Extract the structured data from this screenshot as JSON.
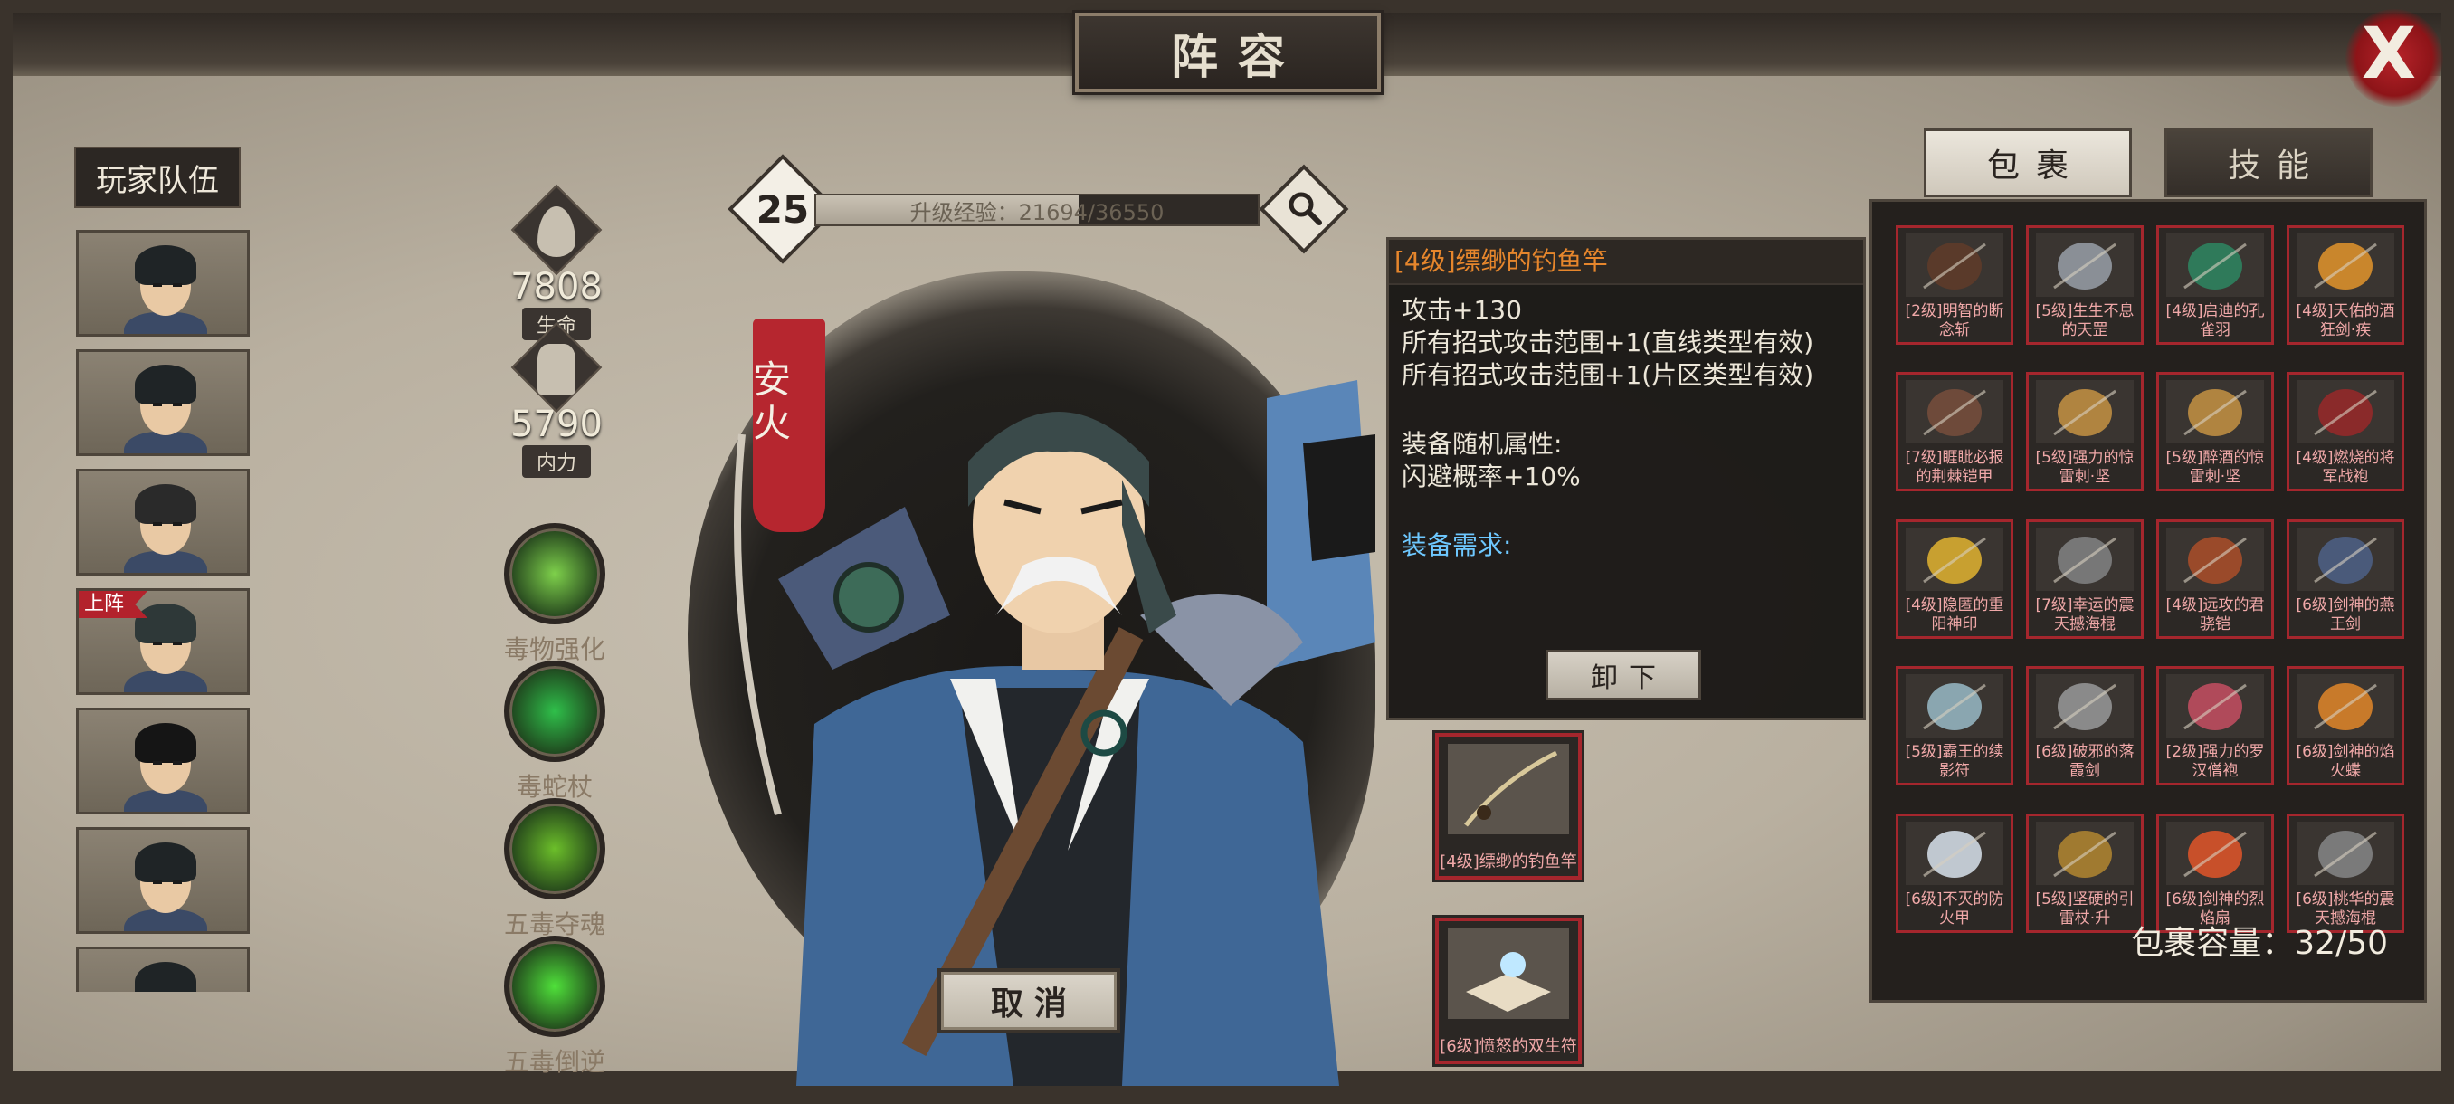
{
  "header": {
    "title": "阵容",
    "close_label": "X"
  },
  "roster": {
    "label": "玩家队伍",
    "heroes": [
      {
        "badge": ""
      },
      {
        "badge": ""
      },
      {
        "badge": ""
      },
      {
        "badge": "上阵"
      },
      {
        "badge": ""
      },
      {
        "badge": ""
      },
      {
        "badge": ""
      }
    ]
  },
  "stats": {
    "hp": {
      "value": "7808",
      "label": "生命"
    },
    "mp": {
      "value": "5790",
      "label": "内力"
    }
  },
  "skills": [
    {
      "name": "毒物强化",
      "color": "#7ed04b"
    },
    {
      "name": "毒蛇杖",
      "color": "#2fbf4a"
    },
    {
      "name": "五毒夺魂",
      "color": "#6cbf2a"
    },
    {
      "name": "五毒倒逆",
      "color": "#4fe03a"
    }
  ],
  "level": {
    "value": "25",
    "exp_label": "升级经验：21694/36550",
    "exp_current": 21694,
    "exp_max": 36550
  },
  "hero": {
    "name": "安火"
  },
  "cancel_label": "取消",
  "tooltip": {
    "title": "[4级]缥缈的钓鱼竿",
    "lines": [
      "攻击+130",
      "所有招式攻击范围+1(直线类型有效)",
      "所有招式攻击范围+1(片区类型有效)"
    ],
    "random_attr_label": "装备随机属性:",
    "random_attr": "闪避概率+10%",
    "requirement_label": "装备需求:",
    "unequip_label": "卸下"
  },
  "equipped": [
    {
      "name": "[4级]缥缈的钓鱼竿"
    },
    {
      "name": "[6级]愤怒的双生符"
    }
  ],
  "tabs": {
    "bag": "包裹",
    "skills": "技能"
  },
  "inventory": {
    "items": [
      {
        "name": "[2级]明智的断念斩",
        "color": "#5a3a2a"
      },
      {
        "name": "[5级]生生不息的天罡",
        "color": "#8a8f96"
      },
      {
        "name": "[4级]启迪的孔雀羽",
        "color": "#2f7a5a"
      },
      {
        "name": "[4级]天佑的酒狂剑·疾",
        "color": "#c9862c"
      },
      {
        "name": "[7级]睚眦必报的荆棘铠甲",
        "color": "#6e4a3a"
      },
      {
        "name": "[5级]强力的惊雷刺·坚",
        "color": "#b08440"
      },
      {
        "name": "[5级]醉酒的惊雷刺·坚",
        "color": "#b08440"
      },
      {
        "name": "[4级]燃烧的将军战袍",
        "color": "#8a2a2a"
      },
      {
        "name": "[4级]隐匿的重阳神印",
        "color": "#c8a030"
      },
      {
        "name": "[7级]幸运的震天撼海棍",
        "color": "#777777"
      },
      {
        "name": "[4级]远攻的君骁铠",
        "color": "#9a4a2a"
      },
      {
        "name": "[6级]剑神的燕王剑",
        "color": "#4a5a7a"
      },
      {
        "name": "[5级]霸王的续影符",
        "color": "#8aa6b0"
      },
      {
        "name": "[6级]破邪的落霞剑",
        "color": "#8a8a8a"
      },
      {
        "name": "[2级]强力的罗汉僧袍",
        "color": "#b04a5a"
      },
      {
        "name": "[6级]剑神的焰火蝶",
        "color": "#c87a2a"
      },
      {
        "name": "[6级]不灭的防火甲",
        "color": "#c0c8d0"
      },
      {
        "name": "[5级]坚硬的引雷杖·升",
        "color": "#a07a30"
      },
      {
        "name": "[6级]剑神的烈焰扇",
        "color": "#c8502a"
      },
      {
        "name": "[6级]桃华的震天撼海棍",
        "color": "#7a7a7a"
      }
    ],
    "capacity_label": "包裹容量：32/50"
  }
}
